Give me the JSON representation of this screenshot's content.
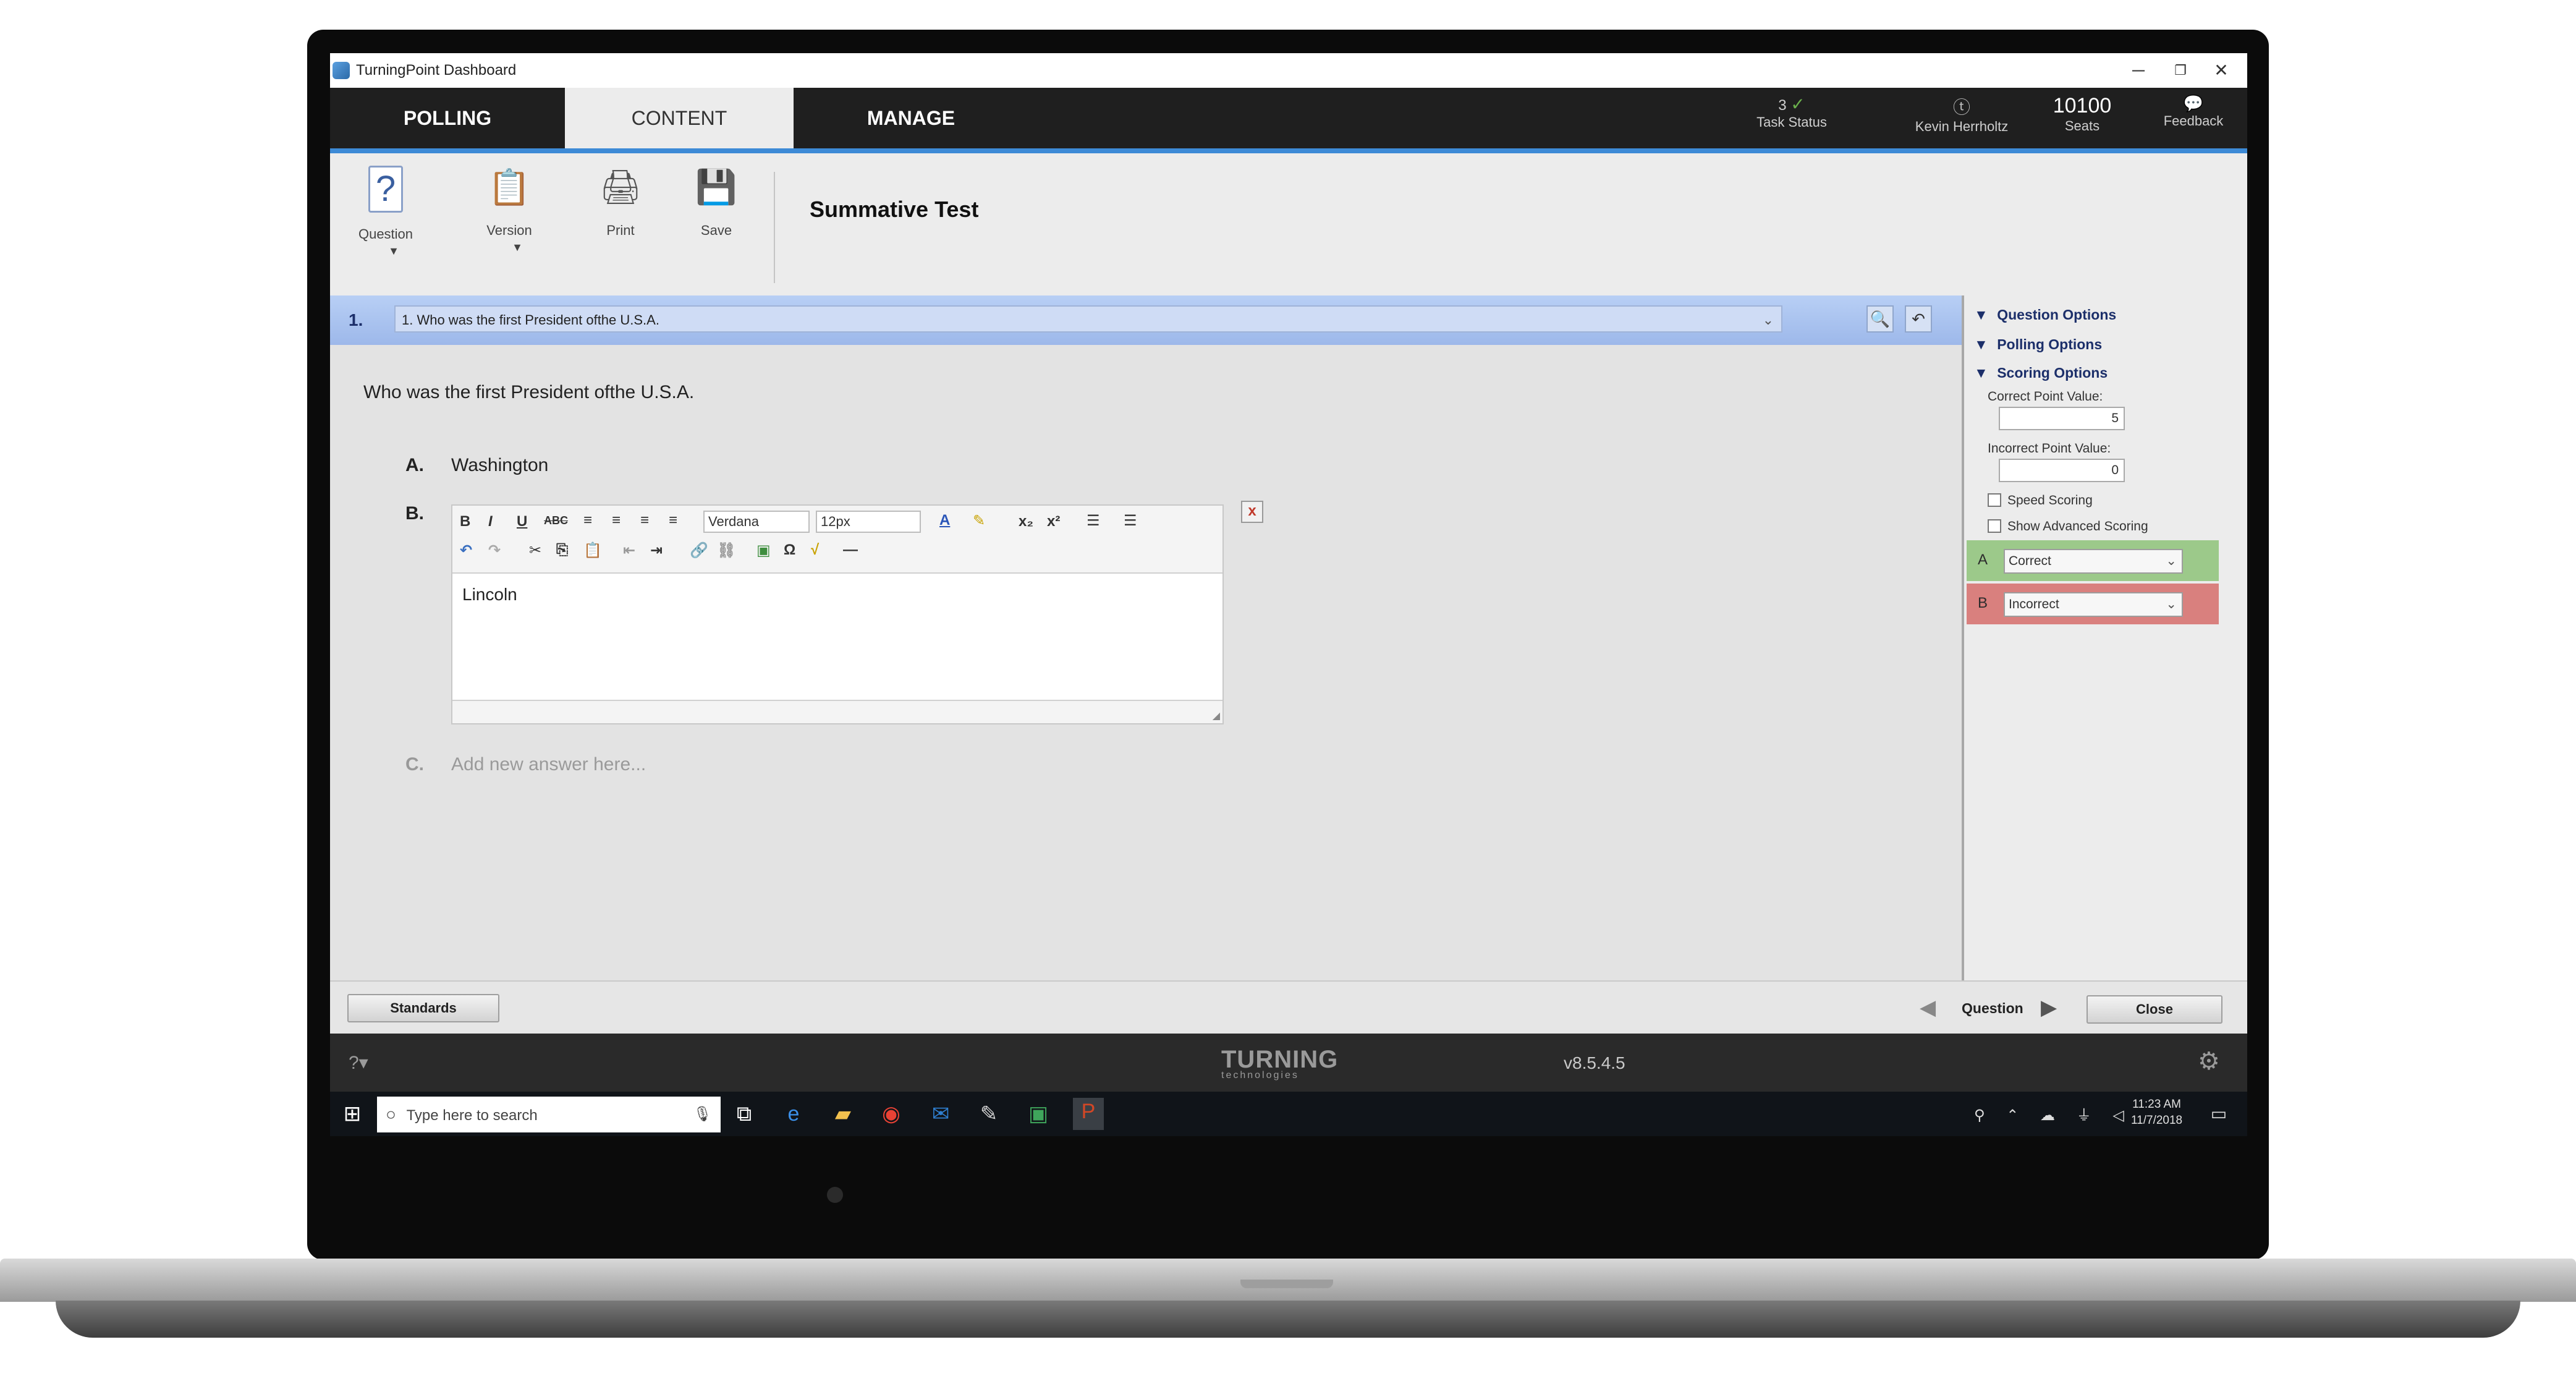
{
  "window": {
    "title": "TurningPoint Dashboard",
    "minimize": "─",
    "restore": "❐",
    "close": "✕"
  },
  "nav": {
    "tabs": [
      "POLLING",
      "CONTENT",
      "MANAGE"
    ],
    "task_status": {
      "count": "3",
      "check": "✓",
      "label": "Task Status"
    },
    "user": {
      "name": "Kevin Herrholtz"
    },
    "seats": {
      "value": "10100",
      "label": "Seats"
    },
    "feedback": {
      "label": "Feedback"
    }
  },
  "toolbar": {
    "question_label": "Question",
    "version_label": "Version",
    "print_label": "Print",
    "save_label": "Save",
    "dropdown_arrow": "▼",
    "doc_title": "Summative Test"
  },
  "question": {
    "number": "1.",
    "selector": "1. Who was the first President ofthe U.S.A.",
    "text": "Who was the first President ofthe U.S.A.",
    "answers": [
      {
        "letter": "A.",
        "text": "Washington"
      },
      {
        "letter": "B.",
        "text": "Lincoln"
      },
      {
        "letter": "C.",
        "placeholder": "Add new answer here..."
      }
    ]
  },
  "rte": {
    "font": "Verdana",
    "size": "12px",
    "close": "x"
  },
  "options": {
    "question_options": "Question Options",
    "polling_options": "Polling Options",
    "scoring_options": "Scoring Options",
    "correct_point_label": "Correct Point Value:",
    "correct_point_value": "5",
    "incorrect_point_label": "Incorrect Point Value:",
    "incorrect_point_value": "0",
    "speed_scoring": "Speed Scoring",
    "show_advanced_scoring": "Show Advanced Scoring",
    "scoring_rows": [
      {
        "letter": "A",
        "value": "Correct",
        "color": "#9cc98a"
      },
      {
        "letter": "B",
        "value": "Incorrect",
        "color": "#d9807e"
      }
    ]
  },
  "bottom": {
    "standards": "Standards",
    "question_nav": "Question",
    "close": "Close"
  },
  "footer": {
    "brand": "TURNING",
    "brand_sub": "technologies",
    "version": "v8.5.4.5"
  },
  "taskbar": {
    "search_placeholder": "Type here to search",
    "time": "11:23 AM",
    "date": "11/7/2018"
  }
}
